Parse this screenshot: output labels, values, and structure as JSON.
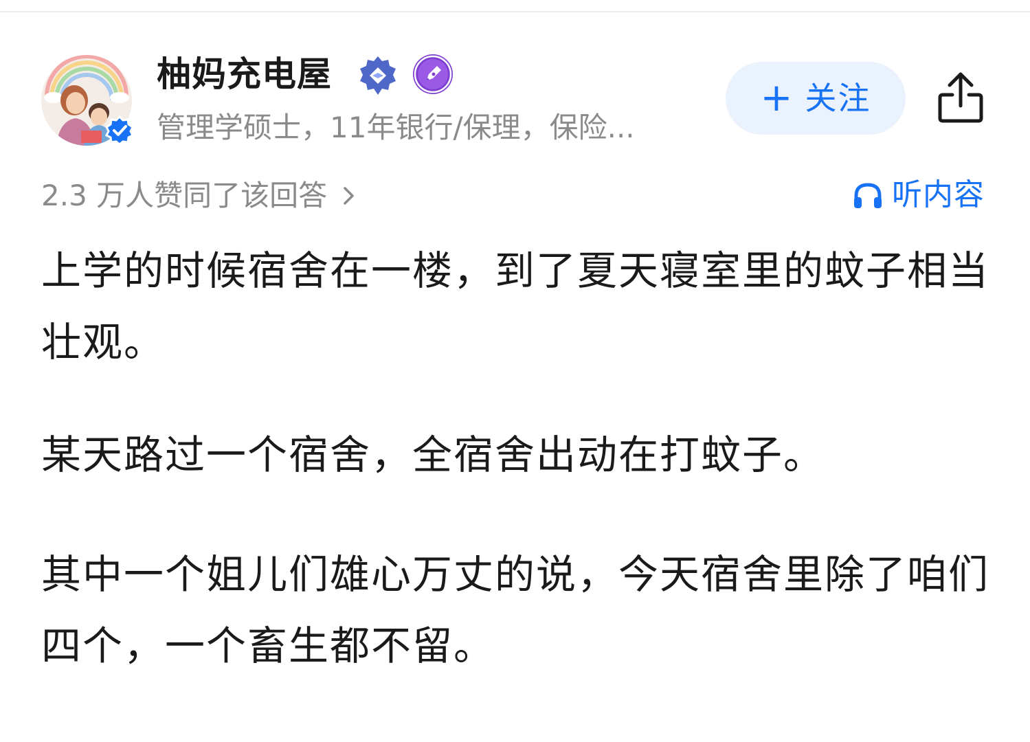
{
  "author": {
    "name": "柚妈充电屋",
    "bio": "管理学硕士，11年银行/保理，保险...",
    "avatar_icon": "avatar-illustration-icon",
    "verified_icon": "verified-check-icon",
    "badges": [
      "creator-level-icon",
      "pen-badge-icon"
    ]
  },
  "follow": {
    "plus": "+",
    "label": "关注"
  },
  "share": {
    "icon": "share-icon"
  },
  "upvote": {
    "text": "2.3 万人赞同了该回答"
  },
  "listen": {
    "label": "听内容",
    "icon": "headphone-icon"
  },
  "content": {
    "paragraphs": [
      "上学的时候宿舍在一楼，到了夏天寝室里的蚊子相当壮观。",
      "某天路过一个宿舍，全宿舍出动在打蚊子。",
      "其中一个姐儿们雄心万丈的说，今天宿舍里除了咱们四个，一个畜生都不留。"
    ]
  },
  "colors": {
    "accent": "#1772f6",
    "follow_bg": "#eaf2fd",
    "secondary_text": "#8a8a8a",
    "primary_text": "#1a1a1a"
  }
}
